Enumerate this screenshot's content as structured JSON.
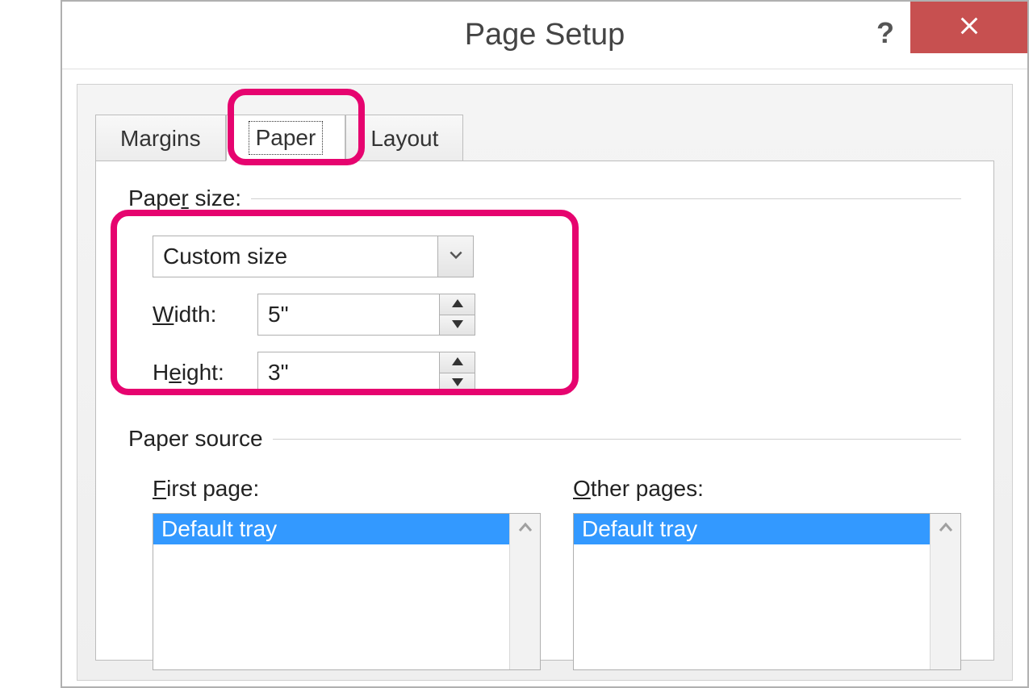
{
  "dialog": {
    "title": "Page Setup"
  },
  "tabs": {
    "margins": "Margins",
    "paper": "Paper",
    "layout": "Layout"
  },
  "paperSize": {
    "label_prefix": "Pape",
    "label_underline": "r",
    "label_suffix": " size:",
    "selected": "Custom size",
    "width_label_underline": "W",
    "width_label_suffix": "idth:",
    "width_value": "5\"",
    "height_label_prefix": "H",
    "height_label_underline": "e",
    "height_label_suffix": "ight:",
    "height_value": "3\""
  },
  "paperSource": {
    "label": "Paper source",
    "firstPage": {
      "label_underline": "F",
      "label_suffix": "irst page:",
      "selected": "Default tray"
    },
    "otherPages": {
      "label_underline": "O",
      "label_suffix": "ther pages:",
      "selected": "Default tray"
    }
  }
}
